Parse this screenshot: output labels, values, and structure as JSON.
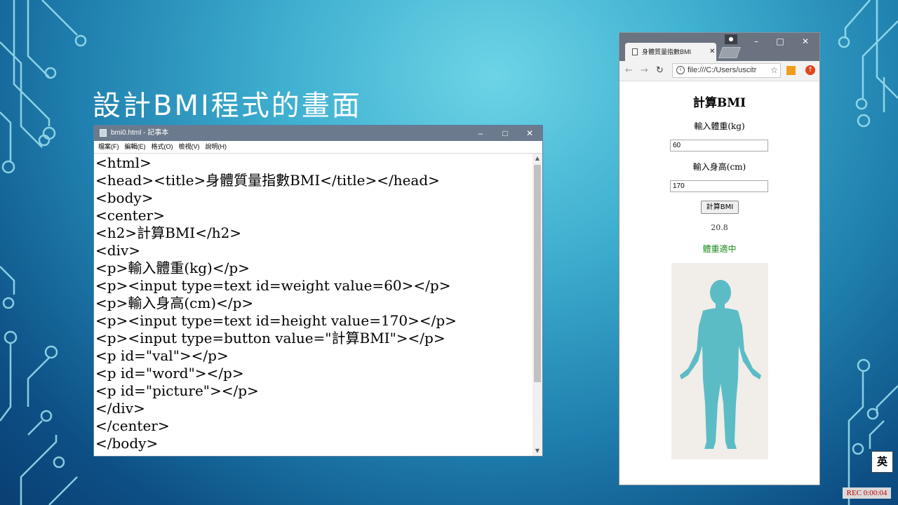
{
  "slide": {
    "title": "設計BMI程式的畫面"
  },
  "notepad": {
    "window_title": "bmi0.html - 記事本",
    "menu": [
      "檔案(F)",
      "編輯(E)",
      "格式(O)",
      "檢視(V)",
      "說明(H)"
    ],
    "lines": [
      "<html>",
      "<head><title>身體質量指數BMI</title></head>",
      "<body>",
      "<center>",
      "<h2>計算BMI</h2>",
      "<div>",
      "<p>輸入體重(kg)</p>",
      "<p><input type=text id=weight value=60></p>",
      "<p>輸入身高(cm)</p>",
      "<p><input type=text id=height value=170></p>",
      "<p><input type=button value=\"計算BMI\"></p>",
      "<p id=\"val\"></p>",
      "<p id=\"word\"></p>",
      "<p id=\"picture\"></p>",
      "</div>",
      "</center>",
      "</body>"
    ]
  },
  "browser": {
    "tab_title": "身體質量指數BMI",
    "address": "file:///C:/Users/uscitr",
    "page": {
      "heading": "計算BMI",
      "weight_label": "輸入體重(kg)",
      "weight_value": "60",
      "height_label": "輸入身高(cm)",
      "height_value": "170",
      "button_label": "計算BMI",
      "result_value": "20.8",
      "result_word": "體重適中",
      "result_word_color": "#1a8a1a",
      "figure_color": "#5bbcc6"
    }
  },
  "taskbar": {
    "ime": "英",
    "rec": "REC 0:00:04"
  }
}
